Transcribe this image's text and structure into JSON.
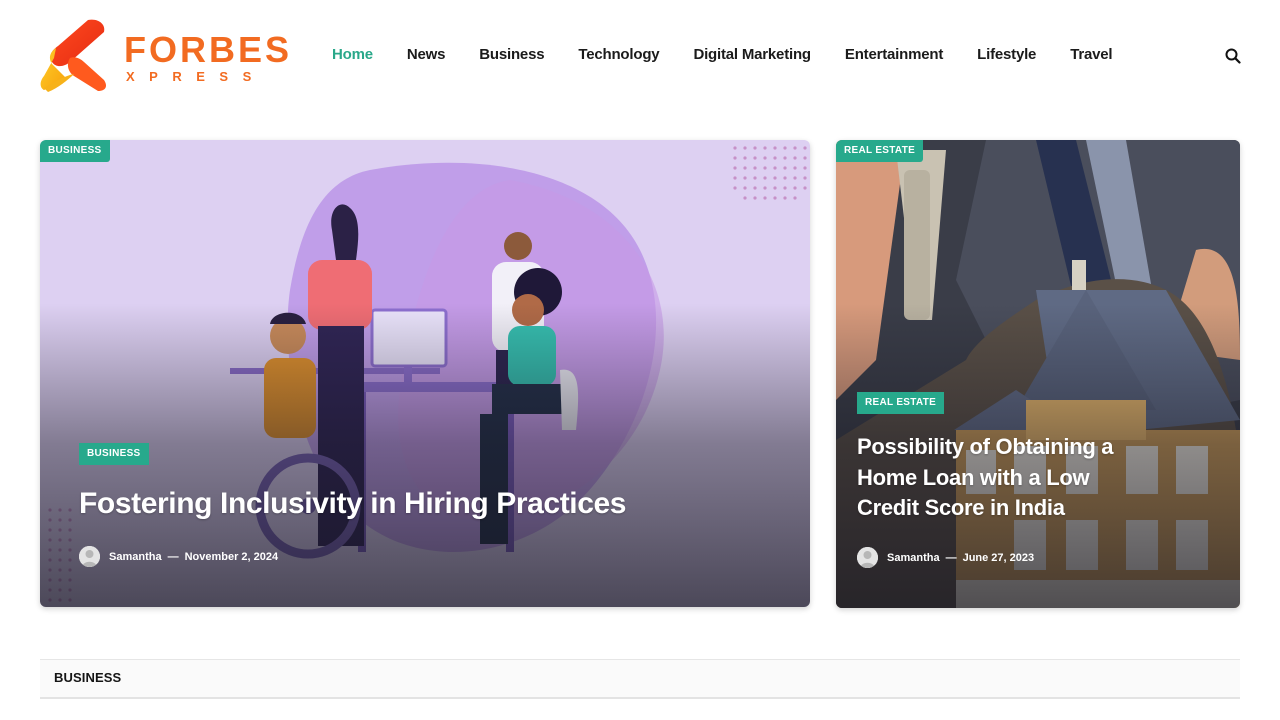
{
  "brand": {
    "name": "FORBES",
    "sub": "XPRESS",
    "accent": "#f26b21"
  },
  "nav": {
    "items": [
      "Home",
      "News",
      "Business",
      "Technology",
      "Digital Marketing",
      "Entertainment",
      "Lifestyle",
      "Travel"
    ],
    "active": "Home",
    "active_color": "#2aa88a",
    "search_icon": "search-icon"
  },
  "featured": {
    "corner_tag": "BUSINESS",
    "tag": "BUSINESS",
    "title": "Fostering Inclusivity in Hiring Practices",
    "author": "Samantha",
    "separator": "—",
    "date": "November 2, 2024"
  },
  "side": {
    "corner_tag": "REAL ESTATE",
    "tag": "REAL ESTATE",
    "title": "Possibility of Obtaining a Home Loan with a Low Credit Score in India",
    "author": "Samantha",
    "separator": "—",
    "date": "June 27, 2023"
  },
  "section": {
    "label": "BUSINESS"
  },
  "colors": {
    "tag_bg": "#27a98c",
    "text": "#1b1b1b"
  }
}
